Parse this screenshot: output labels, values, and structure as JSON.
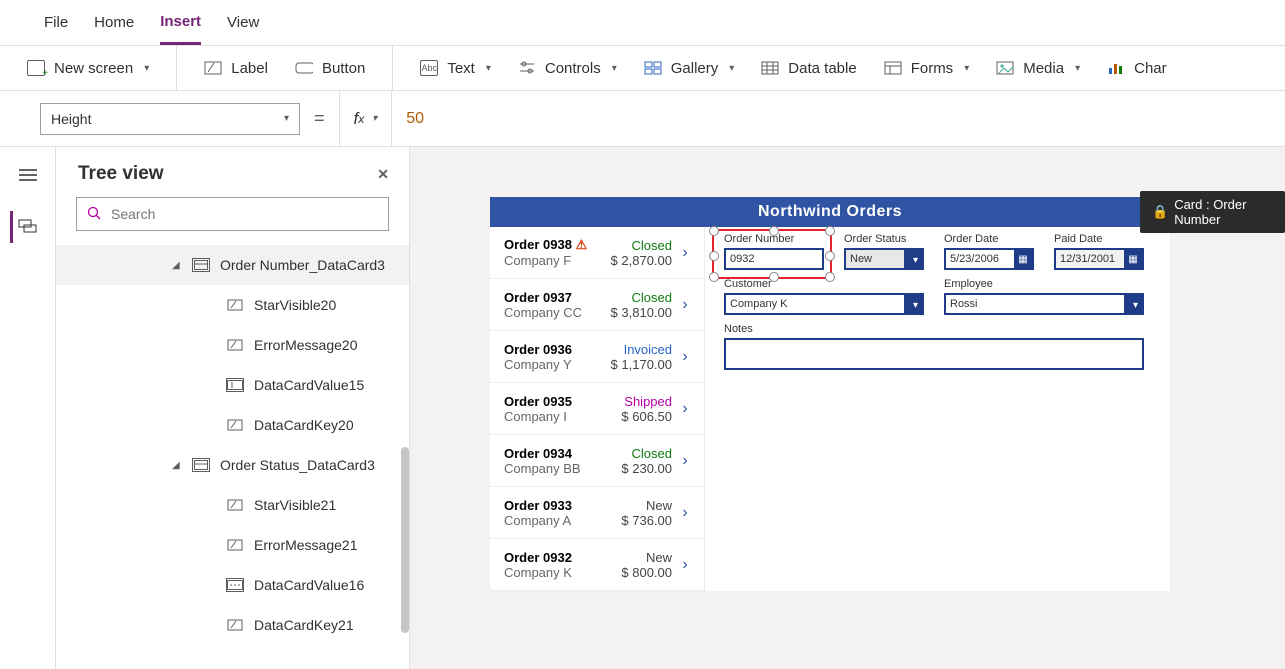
{
  "menu": {
    "file": "File",
    "home": "Home",
    "insert": "Insert",
    "view": "View"
  },
  "ribbon": {
    "new_screen": "New screen",
    "label": "Label",
    "button": "Button",
    "text": "Text",
    "controls": "Controls",
    "gallery": "Gallery",
    "data_table": "Data table",
    "forms": "Forms",
    "media": "Media",
    "chart": "Char"
  },
  "formula": {
    "property": "Height",
    "value": "50"
  },
  "tree": {
    "title": "Tree view",
    "search_placeholder": "Search",
    "cards": [
      {
        "name": "Order Number_DataCard3",
        "children": [
          "StarVisible20",
          "ErrorMessage20",
          "DataCardValue15",
          "DataCardKey20"
        ]
      },
      {
        "name": "Order Status_DataCard3",
        "children": [
          "StarVisible21",
          "ErrorMessage21",
          "DataCardValue16",
          "DataCardKey21"
        ]
      }
    ]
  },
  "tooltip": "Card : Order Number",
  "app_title": "Northwind Orders",
  "orders": [
    {
      "id": "Order 0938",
      "company": "Company F",
      "status": "Closed",
      "amount": "$ 2,870.00",
      "warn": true
    },
    {
      "id": "Order 0937",
      "company": "Company CC",
      "status": "Closed",
      "amount": "$ 3,810.00"
    },
    {
      "id": "Order 0936",
      "company": "Company Y",
      "status": "Invoiced",
      "amount": "$ 1,170.00"
    },
    {
      "id": "Order 0935",
      "company": "Company I",
      "status": "Shipped",
      "amount": "$ 606.50"
    },
    {
      "id": "Order 0934",
      "company": "Company BB",
      "status": "Closed",
      "amount": "$ 230.00"
    },
    {
      "id": "Order 0933",
      "company": "Company A",
      "status": "New",
      "amount": "$ 736.00"
    },
    {
      "id": "Order 0932",
      "company": "Company K",
      "status": "New",
      "amount": "$ 800.00"
    }
  ],
  "form": {
    "labels": {
      "order_number": "Order Number",
      "order_status": "Order Status",
      "order_date": "Order Date",
      "paid_date": "Paid Date",
      "customer": "Customer",
      "employee": "Employee",
      "notes": "Notes"
    },
    "values": {
      "order_number": "0932",
      "order_status": "New",
      "order_date": "5/23/2006",
      "paid_date": "12/31/2001",
      "customer": "Company K",
      "employee": "Rossi",
      "notes": ""
    }
  },
  "icons": {
    "abc": "Abc"
  }
}
